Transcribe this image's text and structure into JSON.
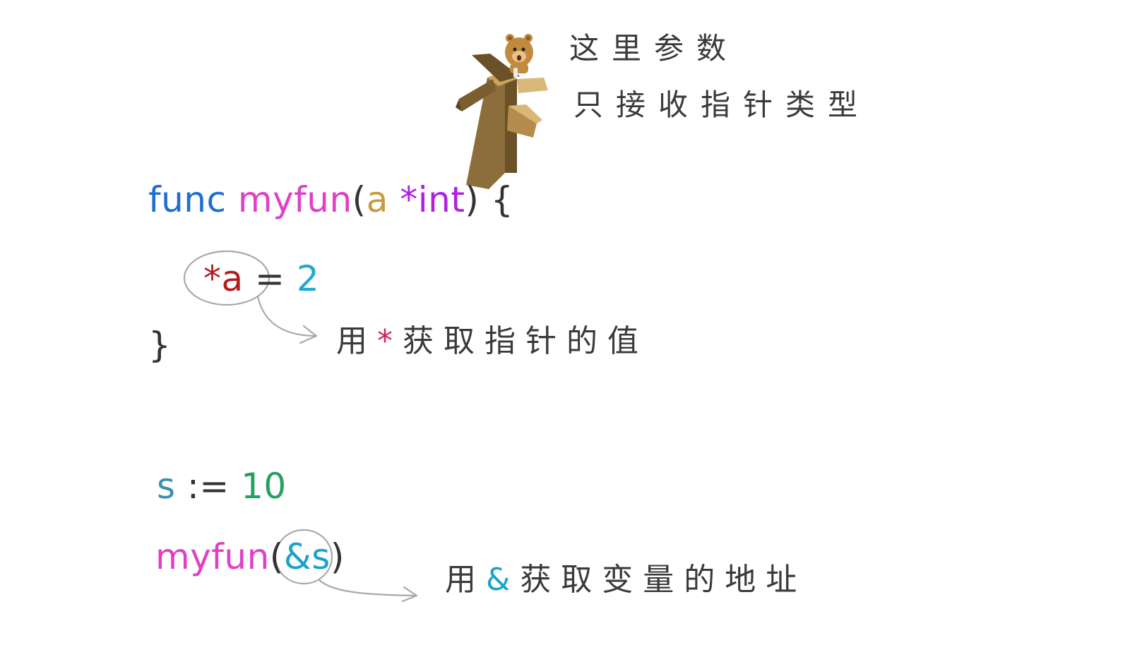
{
  "note_top": {
    "line1": "这里参数",
    "line2": "只接收指针类型"
  },
  "func_def": {
    "keyword": "func",
    "name": "myfun",
    "open_paren": "(",
    "param": "a",
    "ptr_type": "*int",
    "close_paren": ")",
    "brace_open": "{",
    "body_deref": "*a",
    "body_assign": "=",
    "body_value": "2",
    "brace_close": "}"
  },
  "note_deref": {
    "prefix": "用",
    "symbol": "*",
    "suffix": "获取指针的值"
  },
  "call": {
    "var": "s",
    "assign": ":=",
    "value": "10",
    "fn_name": "myfun",
    "open_paren": "(",
    "amp_var": "&s",
    "close_paren": ")"
  },
  "note_addr": {
    "prefix": "用",
    "symbol": "&",
    "suffix": "获取变量的地址"
  },
  "colors": {
    "keyword": "#1f6fd0",
    "function": "#e040c8",
    "param": "#c89a3a",
    "pointer_type": "#b21fe0",
    "deref": "#b31c1c",
    "number": "#20aacc",
    "number_green": "#24a060",
    "variable": "#3a8fb0",
    "ampersand": "#1aa3c9",
    "annotation": "#aaaaaa"
  },
  "icons": {
    "mascot": "bear-on-signpost-icon"
  }
}
